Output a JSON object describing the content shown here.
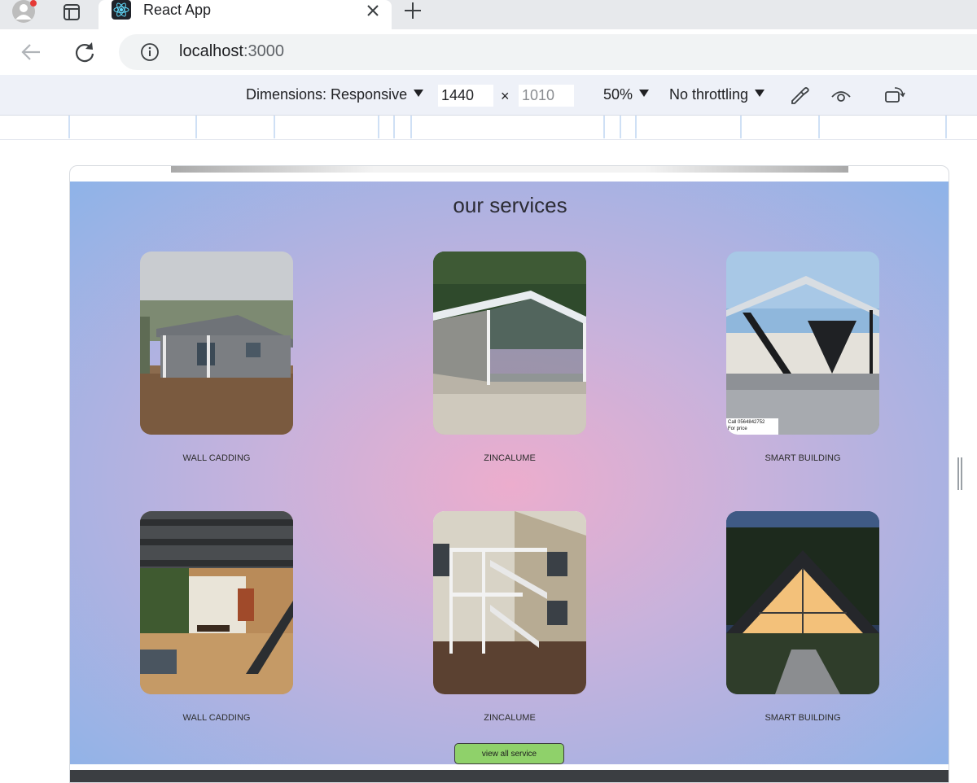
{
  "browser": {
    "tab_title": "React App",
    "url_host": "localhost",
    "url_port": ":3000"
  },
  "devtools": {
    "dimensions_label": "Dimensions: Responsive",
    "width_value": "1440",
    "height_placeholder": "1010",
    "times": "×",
    "zoom": "50%",
    "throttling": "No throttling"
  },
  "page": {
    "services_title": "our services",
    "cards": [
      {
        "label": "WALL CADDING",
        "image": "house-photo"
      },
      {
        "label": "ZINCALUME",
        "image": "carport-photo"
      },
      {
        "label": "SMART BUILDING",
        "image": "pergola-photo",
        "overlay_line1": "Call 0564842752",
        "overlay_line2": "For price"
      },
      {
        "label": "WALL CADDING",
        "image": "interior-photo"
      },
      {
        "label": "ZINCALUME",
        "image": "staircase-photo"
      },
      {
        "label": "SMART BUILDING",
        "image": "aframe-photo"
      }
    ],
    "view_all_label": "view all service"
  },
  "colors": {
    "button": "#8fd16a",
    "gradient_center": "#ecadcd",
    "gradient_edge": "#8eb3e8"
  }
}
